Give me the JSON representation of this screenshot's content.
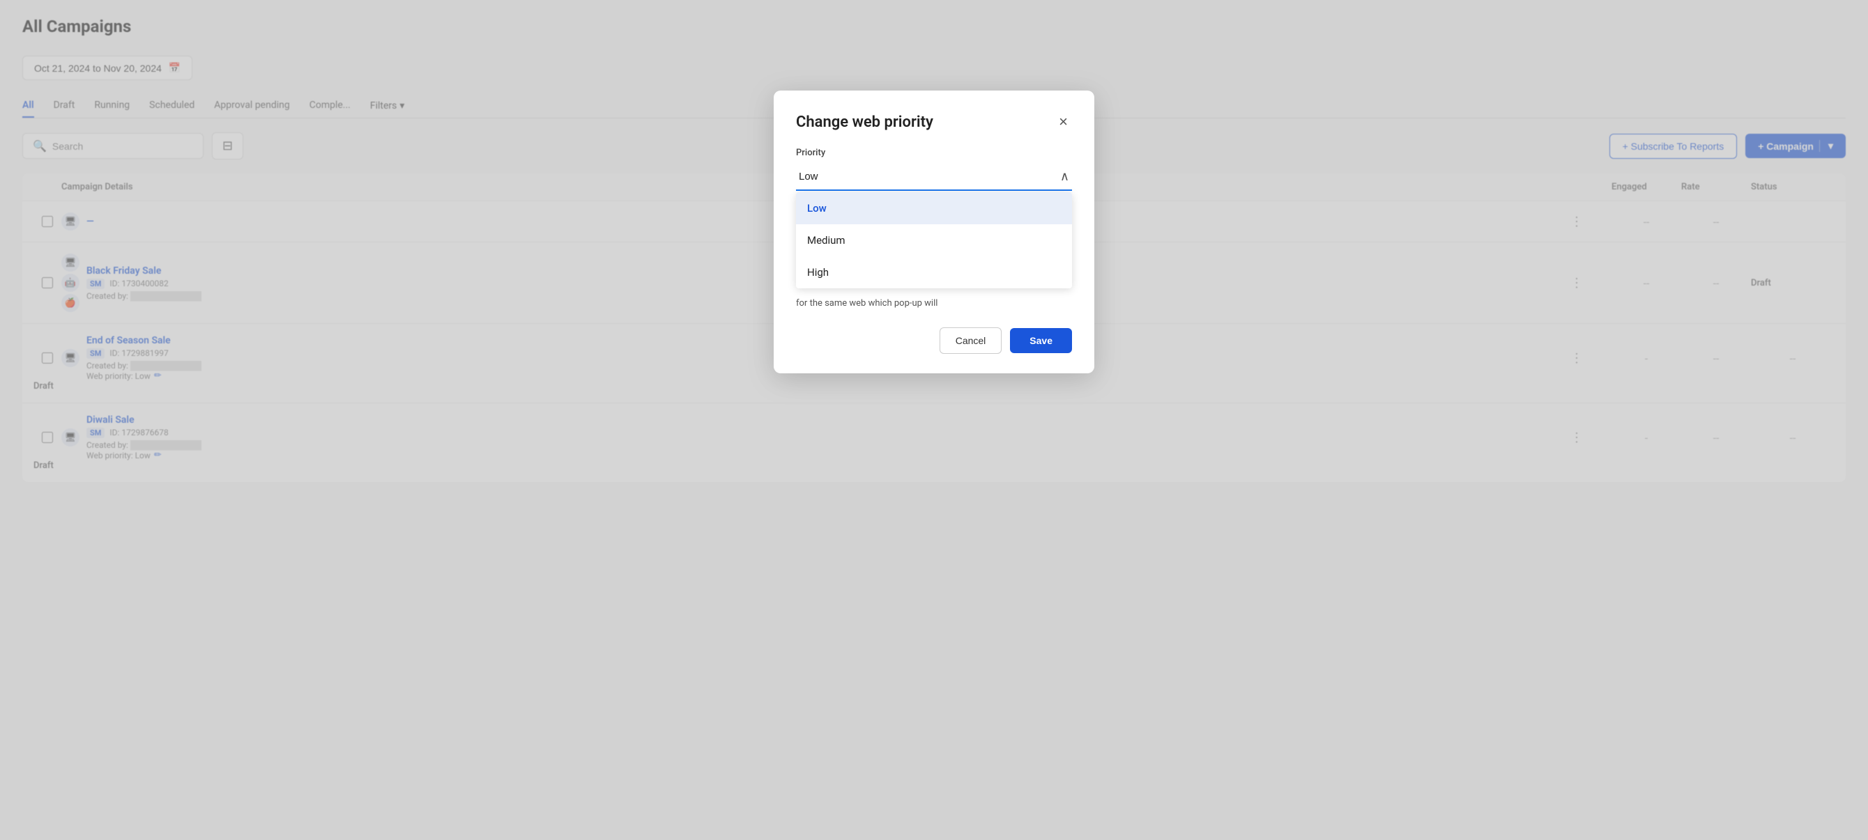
{
  "page": {
    "title": "All Campaigns",
    "date_range": "Oct 21, 2024 to Nov 20, 2024",
    "tabs": [
      {
        "label": "All",
        "active": true
      },
      {
        "label": "Draft",
        "active": false
      },
      {
        "label": "Running",
        "active": false
      },
      {
        "label": "Scheduled",
        "active": false
      },
      {
        "label": "Approval pending",
        "active": false
      },
      {
        "label": "Comple...",
        "active": false
      }
    ],
    "search_placeholder": "Search",
    "filter_icon": "≡",
    "subscribe_label": "+ Subscribe To Reports",
    "campaign_label": "+ Campaign",
    "more_filters_label": "Filters",
    "table": {
      "headers": [
        "",
        "Campaign Details",
        "",
        "Engaged",
        "Rate",
        "Status"
      ],
      "rows": [
        {
          "id": "row1",
          "name": "",
          "meta": "",
          "icons": [],
          "three_dot": "⋮",
          "dash1": "-",
          "engaged": "--",
          "rate": "--",
          "status": ""
        },
        {
          "id": "row2",
          "name": "Black Friday Sale",
          "badge": "SM",
          "campaign_id": "ID: 1730400082",
          "created_by": "Created by:",
          "icons": [
            "🖥",
            "🤖",
            "🍎"
          ],
          "three_dot": "⋮",
          "dash1": "",
          "engaged": "--",
          "rate": "--",
          "status": "Draft"
        },
        {
          "id": "row3",
          "name": "End of Season Sale",
          "badge": "SM",
          "campaign_id": "ID: 1729881997",
          "created_by": "Created by:",
          "web_priority": "Web priority: Low",
          "icons": [
            "🖥"
          ],
          "three_dot": "⋮",
          "dash1": "-",
          "engaged": "--",
          "rate": "--",
          "status": "Draft"
        },
        {
          "id": "row4",
          "name": "Diwali Sale",
          "badge": "SM",
          "campaign_id": "ID: 1729876678",
          "created_by": "Created by:",
          "web_priority": "Web priority: Low",
          "icons": [
            "🖥"
          ],
          "three_dot": "⋮",
          "dash1": "-",
          "engaged": "--",
          "rate": "--",
          "status": "Draft"
        }
      ]
    }
  },
  "modal": {
    "title": "Change web priority",
    "priority_label": "Priority",
    "selected_value": "Low",
    "info_text": "for the same web which pop-up will",
    "options": [
      {
        "label": "Low",
        "selected": true
      },
      {
        "label": "Medium",
        "selected": false
      },
      {
        "label": "High",
        "selected": false
      }
    ],
    "cancel_label": "Cancel",
    "save_label": "Save"
  }
}
